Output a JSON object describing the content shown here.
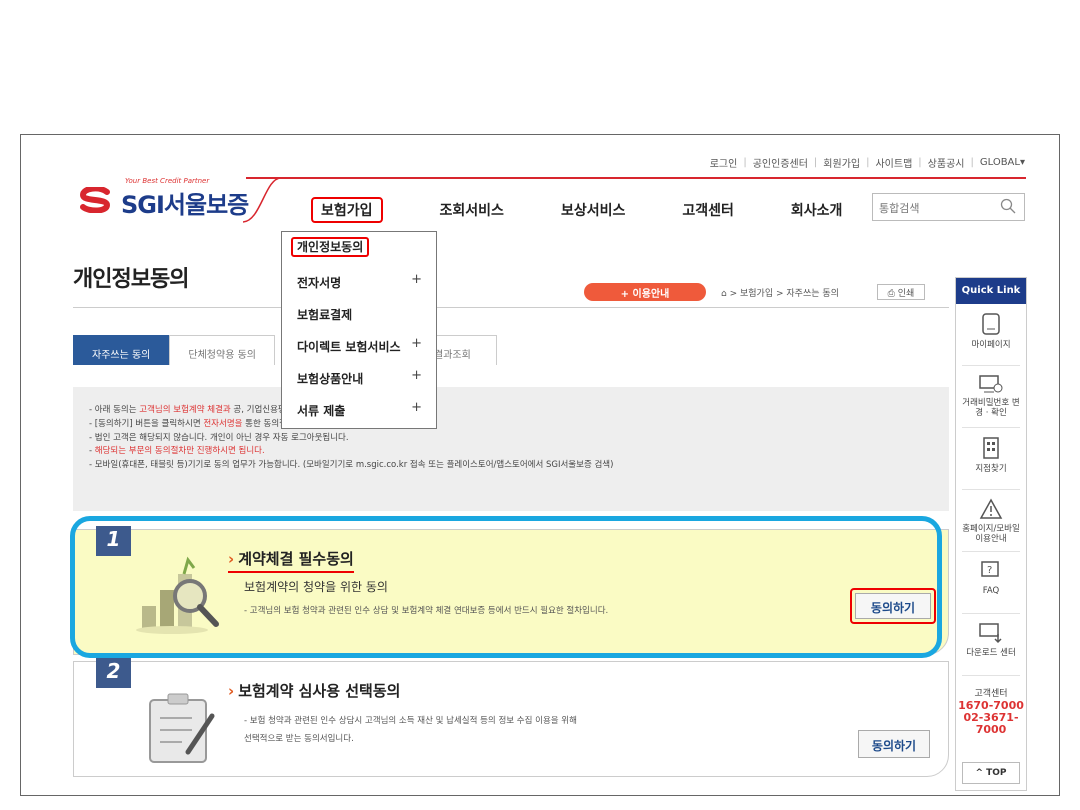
{
  "util_links": [
    "로그인",
    "공인인증센터",
    "회원가입",
    "사이트맵",
    "상품공시",
    "GLOBAL▾"
  ],
  "logo": {
    "tagline": "Your Best Credit Partner",
    "name": "SGI서울보증"
  },
  "gnb": [
    "보험가입",
    "조회서비스",
    "보상서비스",
    "고객센터",
    "회사소개"
  ],
  "search": {
    "placeholder": "통합검색"
  },
  "dropdown": [
    {
      "label": "개인정보동의",
      "plus": ""
    },
    {
      "label": "전자서명",
      "plus": "+"
    },
    {
      "label": "보험료결제",
      "plus": ""
    },
    {
      "label": "다이렉트 보험서비스",
      "plus": "+"
    },
    {
      "label": "보험상품안내",
      "plus": "+"
    },
    {
      "label": "서류 제출",
      "plus": "+"
    }
  ],
  "page_title": "개인정보동의",
  "guide_button": "+ 이용안내",
  "breadcrumb": "> 보험가입 > 자주쓰는 동의",
  "print_label": "인쇄",
  "tabs": [
    "자주쓰는 동의",
    "단체청약용 동의",
    "결과조회"
  ],
  "notice": [
    {
      "pre": "- 아래 동의는 ",
      "red": "고객님의 보험계약 체결과",
      "post": "          공, 기업신용평가 등을 위한 사전 동의절차 입니다."
    },
    {
      "pre": "- [동의하기] 버튼을 클릭하시면 ",
      "red": "전자서명을",
      "post": " 통한 동의절차가 진행됩니다."
    },
    {
      "pre": "- 법인 고객은 해당되지 않습니다. 개인이 아닌 경우 자동 로그아웃됩니다.",
      "red": "",
      "post": ""
    },
    {
      "pre": "- ",
      "red": "해당되는 부문의 동의절차만 진행하시면 됩니다.",
      "post": ""
    },
    {
      "pre": "- 모바일(휴대폰, 태블릿 등)기기로 동의 업무가 가능합니다. (모바일기기로 m.sgic.co.kr 접속 또는 플레이스토어/앱스토어에서 SGI서울보증 검색)",
      "red": "",
      "post": ""
    }
  ],
  "cards": [
    {
      "num": "1",
      "title": "계약체결 필수동의",
      "sub": "보험계약의 청약을 위한 동의",
      "desc": [
        "- 고객님의 보험 청약과 관련된 인수 상담 및 보험계약 체결 연대보증 등에서 반드시 필요한 절차입니다."
      ],
      "button": "동의하기"
    },
    {
      "num": "2",
      "title": "보험계약 심사용 선택동의",
      "sub": "",
      "desc": [
        "- 보험 청약과 관련된 인수 상담시 고객님의 소득 재산 및 납세실적 등의 정보 수집 이용을 위해",
        "  선택적으로 받는 동의서입니다."
      ],
      "button": "동의하기"
    }
  ],
  "quick_link": {
    "title": "Quick Link",
    "items": [
      "마이페이지",
      "거래비밀번호 변경 · 확인",
      "지점찾기",
      "홈페이지/모바일 이용안내",
      "FAQ",
      "다운로드 센터"
    ],
    "cs_label": "고객센터",
    "tel1": "1670-7000",
    "tel2": "02-3671-7000",
    "top": "^ TOP"
  },
  "colors": {
    "brand": "#1d3c8a",
    "accent_red": "#d8262e",
    "highlight_blue": "#1aa7e0",
    "card_yellow": "#fafbc4"
  }
}
